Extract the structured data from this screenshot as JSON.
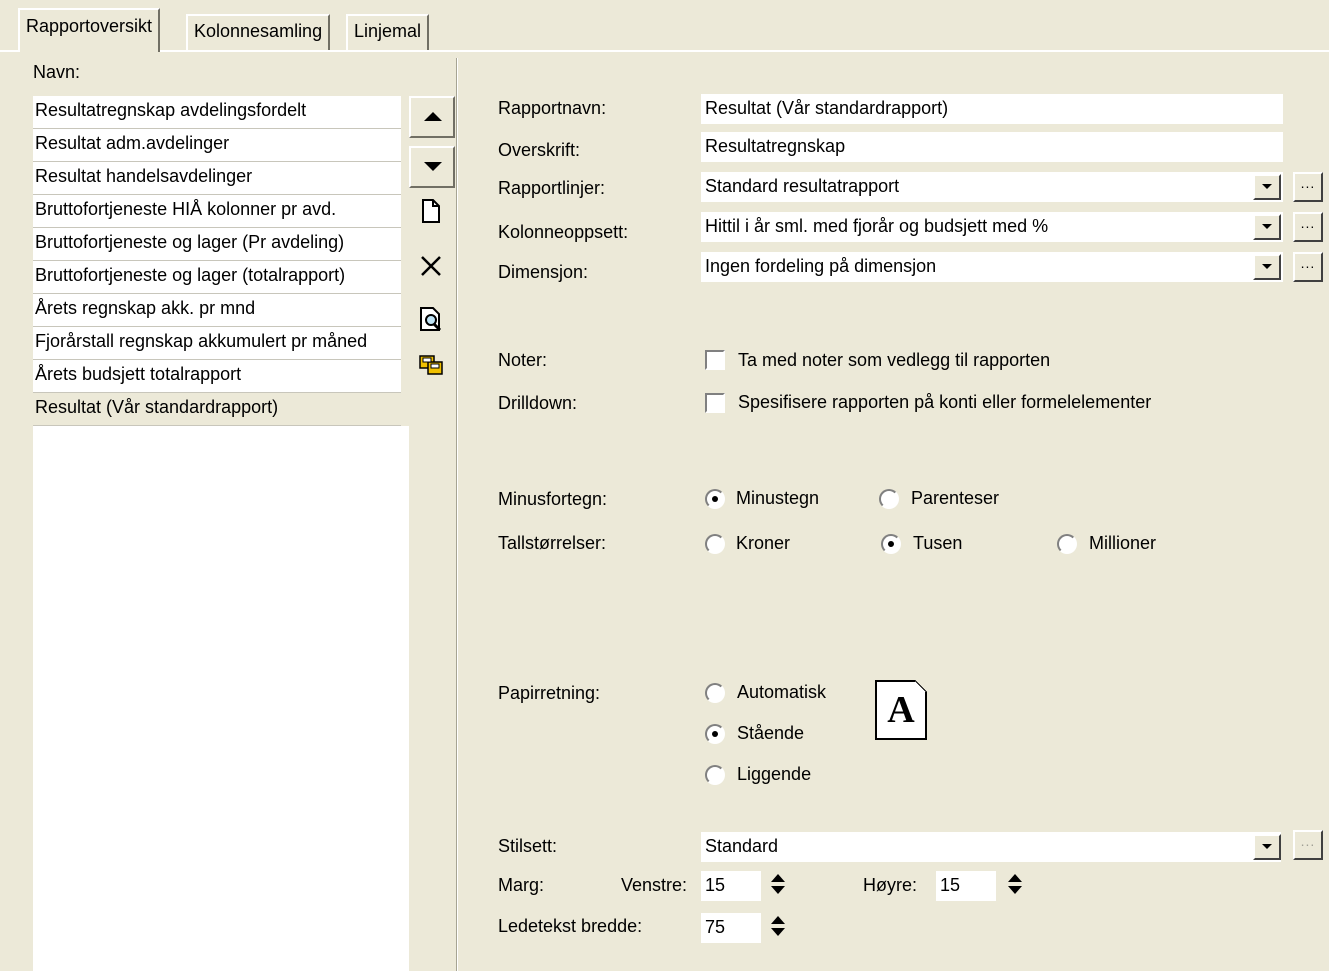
{
  "tabs": [
    {
      "label": "Rapportoversikt",
      "active": true
    },
    {
      "label": "Kolonnesamling",
      "active": false
    },
    {
      "label": "Linjemal",
      "active": false
    }
  ],
  "list": {
    "header": "Navn:",
    "items": [
      "Resultatregnskap avdelingsfordelt",
      "Resultat adm.avdelinger",
      "Resultat handelsavdelinger",
      "Bruttofortjeneste HIÅ kolonner pr avd.",
      "Bruttofortjeneste og lager (Pr avdeling)",
      "Bruttofortjeneste og lager (totalrapport)",
      "Årets regnskap akk. pr mnd",
      "Fjorårstall regnskap akkumulert pr måned",
      "Årets budsjett totalrapport",
      "Resultat (Vår standardrapport)"
    ],
    "selected_index": 9
  },
  "toolbar_icons": [
    "move-up-icon",
    "move-down-icon",
    "new-document-icon",
    "delete-icon",
    "preview-icon",
    "copy-icon"
  ],
  "form": {
    "rapportnavn": {
      "label": "Rapportnavn:",
      "value": "Resultat (Vår standardrapport)"
    },
    "overskrift": {
      "label": "Overskrift:",
      "value": "Resultatregnskap"
    },
    "rapportlinjer": {
      "label": "Rapportlinjer:",
      "value": "Standard resultatrapport"
    },
    "kolonneoppsett": {
      "label": "Kolonneoppsett:",
      "value": "Hittil i år sml. med fjorår og budsjett med %"
    },
    "dimensjon": {
      "label": "Dimensjon:",
      "value": "Ingen fordeling på dimensjon"
    },
    "dots_label": "...",
    "noter": {
      "label": "Noter:",
      "checkbox_label": "Ta med noter som vedlegg til rapporten",
      "checked": false
    },
    "drilldown": {
      "label": "Drilldown:",
      "checkbox_label": "Spesifisere rapporten på konti eller formelelementer",
      "checked": false
    },
    "minusfortegn": {
      "label": "Minusfortegn:",
      "options": [
        "Minustegn",
        "Parenteser"
      ],
      "selected": "Minustegn"
    },
    "tallstorrelser": {
      "label": "Tallstørrelser:",
      "options": [
        "Kroner",
        "Tusen",
        "Millioner"
      ],
      "selected": "Tusen"
    },
    "papirretning": {
      "label": "Papirretning:",
      "options": [
        "Automatisk",
        "Stående",
        "Liggende"
      ],
      "selected": "Stående",
      "icon_letter": "A"
    },
    "stilsett": {
      "label": "Stilsett:",
      "value": "Standard"
    },
    "marg": {
      "label": "Marg:",
      "venstre_label": "Venstre:",
      "venstre_value": "15",
      "hoyre_label": "Høyre:",
      "hoyre_value": "15"
    },
    "ledetekst": {
      "label": "Ledetekst bredde:",
      "value": "75"
    }
  }
}
